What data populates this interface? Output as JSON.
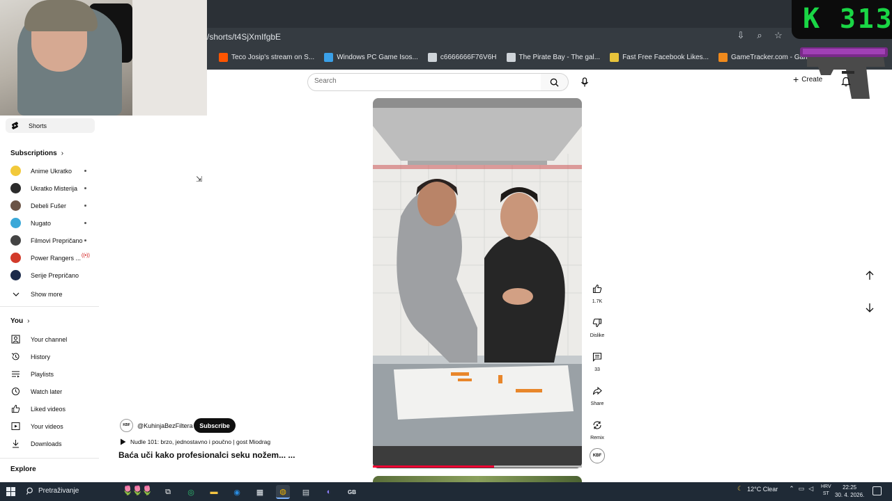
{
  "browser": {
    "url": "/shorts/t4SjXmIfgbE",
    "bookmarks": [
      {
        "label": "Teco Josip's stream on S...",
        "color": "#ff5500"
      },
      {
        "label": "Windows PC Game Isos...",
        "color": "#3aa0e8"
      },
      {
        "label": "c6666666F76V6H",
        "color": "#cfd4d9"
      },
      {
        "label": "The Pirate Bay - The gal...",
        "color": "#cfd4d9"
      },
      {
        "label": "Fast Free Facebook Likes...",
        "color": "#e8c33a"
      },
      {
        "label": "GameTracker.com - Gam...",
        "color": "#f08a1c"
      }
    ]
  },
  "overlay": {
    "counter_letter": "K",
    "counter_value": "313"
  },
  "header": {
    "search_placeholder": "Search",
    "create_label": "Create"
  },
  "sidebar": {
    "shorts_label": "Shorts",
    "subscriptions_label": "Subscriptions",
    "subscriptions": [
      {
        "label": "Anime Ukratko",
        "color": "#f2c93a",
        "status": "dot"
      },
      {
        "label": "Ukratko Misterija",
        "color": "#2b2b2b",
        "status": "dot"
      },
      {
        "label": "Debeli Fušer",
        "color": "#6b5446",
        "status": "dot"
      },
      {
        "label": "Nugato",
        "color": "#3aa8d8",
        "status": "dot"
      },
      {
        "label": "Filmovi Prepričano",
        "color": "#444444",
        "status": "dot"
      },
      {
        "label": "Power Rangers ...",
        "color": "#d23a2a",
        "status": "live"
      },
      {
        "label": "Serije Prepričano",
        "color": "#1c2a4a",
        "status": "none"
      }
    ],
    "show_more_label": "Show more",
    "you_label": "You",
    "you_items": [
      {
        "label": "Your channel",
        "icon": "person-icon"
      },
      {
        "label": "History",
        "icon": "history-icon"
      },
      {
        "label": "Playlists",
        "icon": "playlists-icon"
      },
      {
        "label": "Watch later",
        "icon": "clock-icon"
      },
      {
        "label": "Liked videos",
        "icon": "thumbs-up-icon"
      },
      {
        "label": "Your videos",
        "icon": "play-square-icon"
      },
      {
        "label": "Downloads",
        "icon": "download-icon"
      }
    ],
    "explore_label": "Explore"
  },
  "short": {
    "progress": 0.58,
    "actions": {
      "likes": "1.7K",
      "dislike_label": "Dislike",
      "comments": "33",
      "share_label": "Share",
      "remix_label": "Remix"
    },
    "channel_avatar_text": "KBF",
    "channel_handle": "@KuhinjaBezFiltera",
    "subscribe_label": "Subscribe",
    "playlist_text": "Nudle 101: brzo, jednostavno i poučno | gost Miodrag",
    "title": "Baća uči kako profesionalci seku nožem...  ..."
  },
  "taskbar": {
    "search_label": "Pretraživanje",
    "weather": "12°C  Clear",
    "language": [
      "HRV",
      "ST"
    ],
    "time": "22:25",
    "date": "30. 4. 2026."
  }
}
